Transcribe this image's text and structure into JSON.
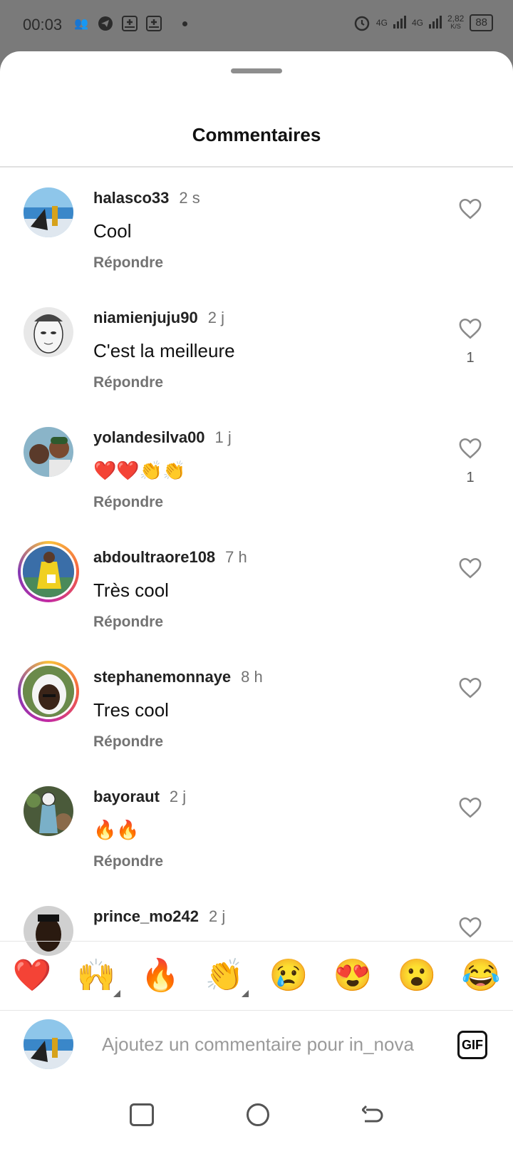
{
  "status_bar": {
    "time": "00:03",
    "signal1": "4G",
    "signal2": "4G",
    "speed": "2,82",
    "speed_unit": "K/S",
    "battery": "88"
  },
  "header": {
    "title": "Commentaires"
  },
  "comments": [
    {
      "user": "halasco33",
      "time": "2 s",
      "text": "Cool",
      "reply": "Répondre",
      "likes": ""
    },
    {
      "user": "niamienjuju90",
      "time": "2 j",
      "text": "C'est la meilleure",
      "reply": "Répondre",
      "likes": "1"
    },
    {
      "user": "yolandesilva00",
      "time": "1 j",
      "text": "❤️❤️👏👏",
      "reply": "Répondre",
      "likes": "1"
    },
    {
      "user": "abdoultraore108",
      "time": "7 h",
      "text": "Très cool",
      "reply": "Répondre",
      "likes": ""
    },
    {
      "user": "stephanemonnaye",
      "time": "8 h",
      "text": "Tres cool",
      "reply": "Répondre",
      "likes": ""
    },
    {
      "user": "bayoraut",
      "time": "2 j",
      "text": "🔥🔥",
      "reply": "Répondre",
      "likes": ""
    },
    {
      "user": "prince_mo242",
      "time": "2 j",
      "text": "",
      "reply": "",
      "likes": ""
    }
  ],
  "emoji_bar": [
    "❤️",
    "🙌",
    "🔥",
    "👏",
    "😢",
    "😍",
    "😮",
    "😂"
  ],
  "composer": {
    "placeholder": "Ajoutez un commentaire pour in_nova",
    "gif_label": "GIF"
  },
  "accent_colors": {
    "story_ring_start": "#f9c23c",
    "story_ring_end": "#833ab4"
  }
}
